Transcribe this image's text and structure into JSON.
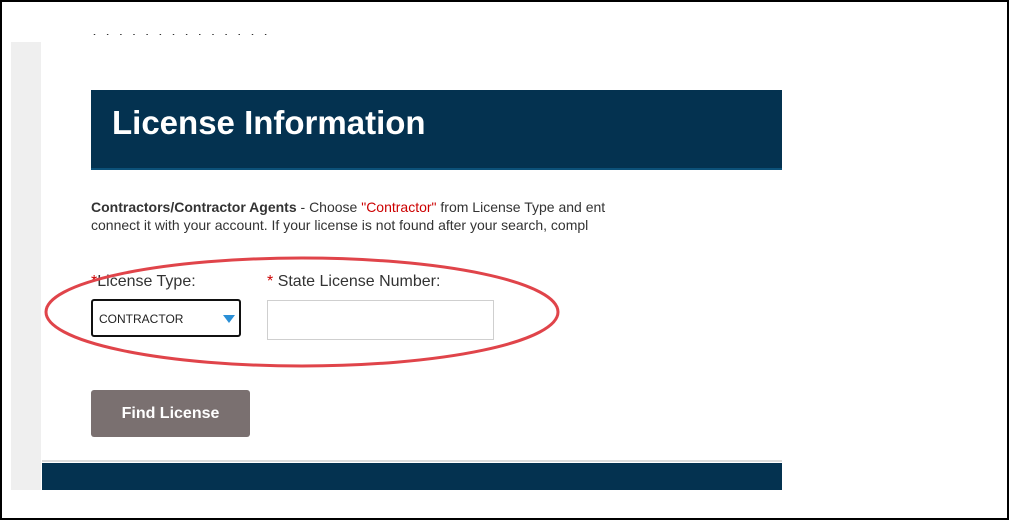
{
  "cutoff_text": "· · · · · · · · · · · · · ·",
  "header": {
    "title": "License Information"
  },
  "instructions": {
    "lead_bold": "Contractors/Contractor Agents",
    "part1": " - Choose ",
    "quoted": "\"Contractor\"",
    "part2": " from License Type and ent",
    "line2": "connect it with your account. If your license is not found after your search, compl"
  },
  "form": {
    "required_marker": "*",
    "license_type_label": "License Type:",
    "license_type_value": "CONTRACTOR",
    "state_number_label": "State License Number:",
    "state_number_value": "",
    "find_button_label": "Find License"
  },
  "colors": {
    "header_bg": "#043250",
    "required": "#cc0000",
    "button_bg": "#7a7070",
    "annotation": "#e0444a",
    "caret": "#2a8fd6"
  },
  "icons": {
    "select_caret": "chevron-down-icon"
  }
}
